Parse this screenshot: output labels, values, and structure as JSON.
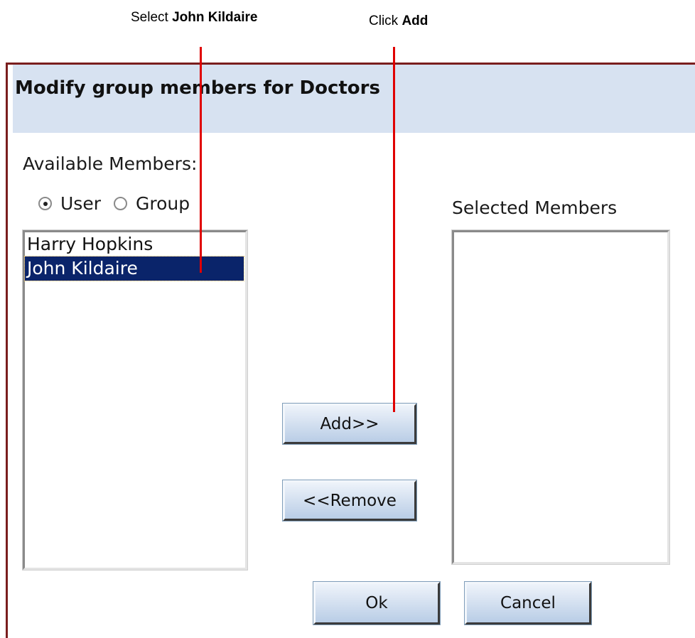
{
  "callouts": {
    "select": {
      "prefix": "Select ",
      "bold": "John Kildaire"
    },
    "add": {
      "prefix": "Click ",
      "bold": "Add"
    }
  },
  "dialog": {
    "title": "Modify group members for Doctors",
    "available_label": "Available Members:",
    "selected_label": "Selected Members",
    "member_type": {
      "options": [
        {
          "label": "User",
          "checked": true
        },
        {
          "label": "Group",
          "checked": false
        }
      ]
    },
    "available_members": [
      {
        "name": "Harry Hopkins",
        "selected": false
      },
      {
        "name": "John Kildaire",
        "selected": true
      }
    ],
    "selected_members": [],
    "buttons": {
      "add": "Add>>",
      "remove": "<<Remove",
      "ok": "Ok",
      "cancel": "Cancel"
    }
  },
  "colors": {
    "header_bg": "#d7e2f1",
    "selection_bg": "#0a246a",
    "pointer": "#e00000",
    "dialog_border": "#7a1e1e"
  }
}
